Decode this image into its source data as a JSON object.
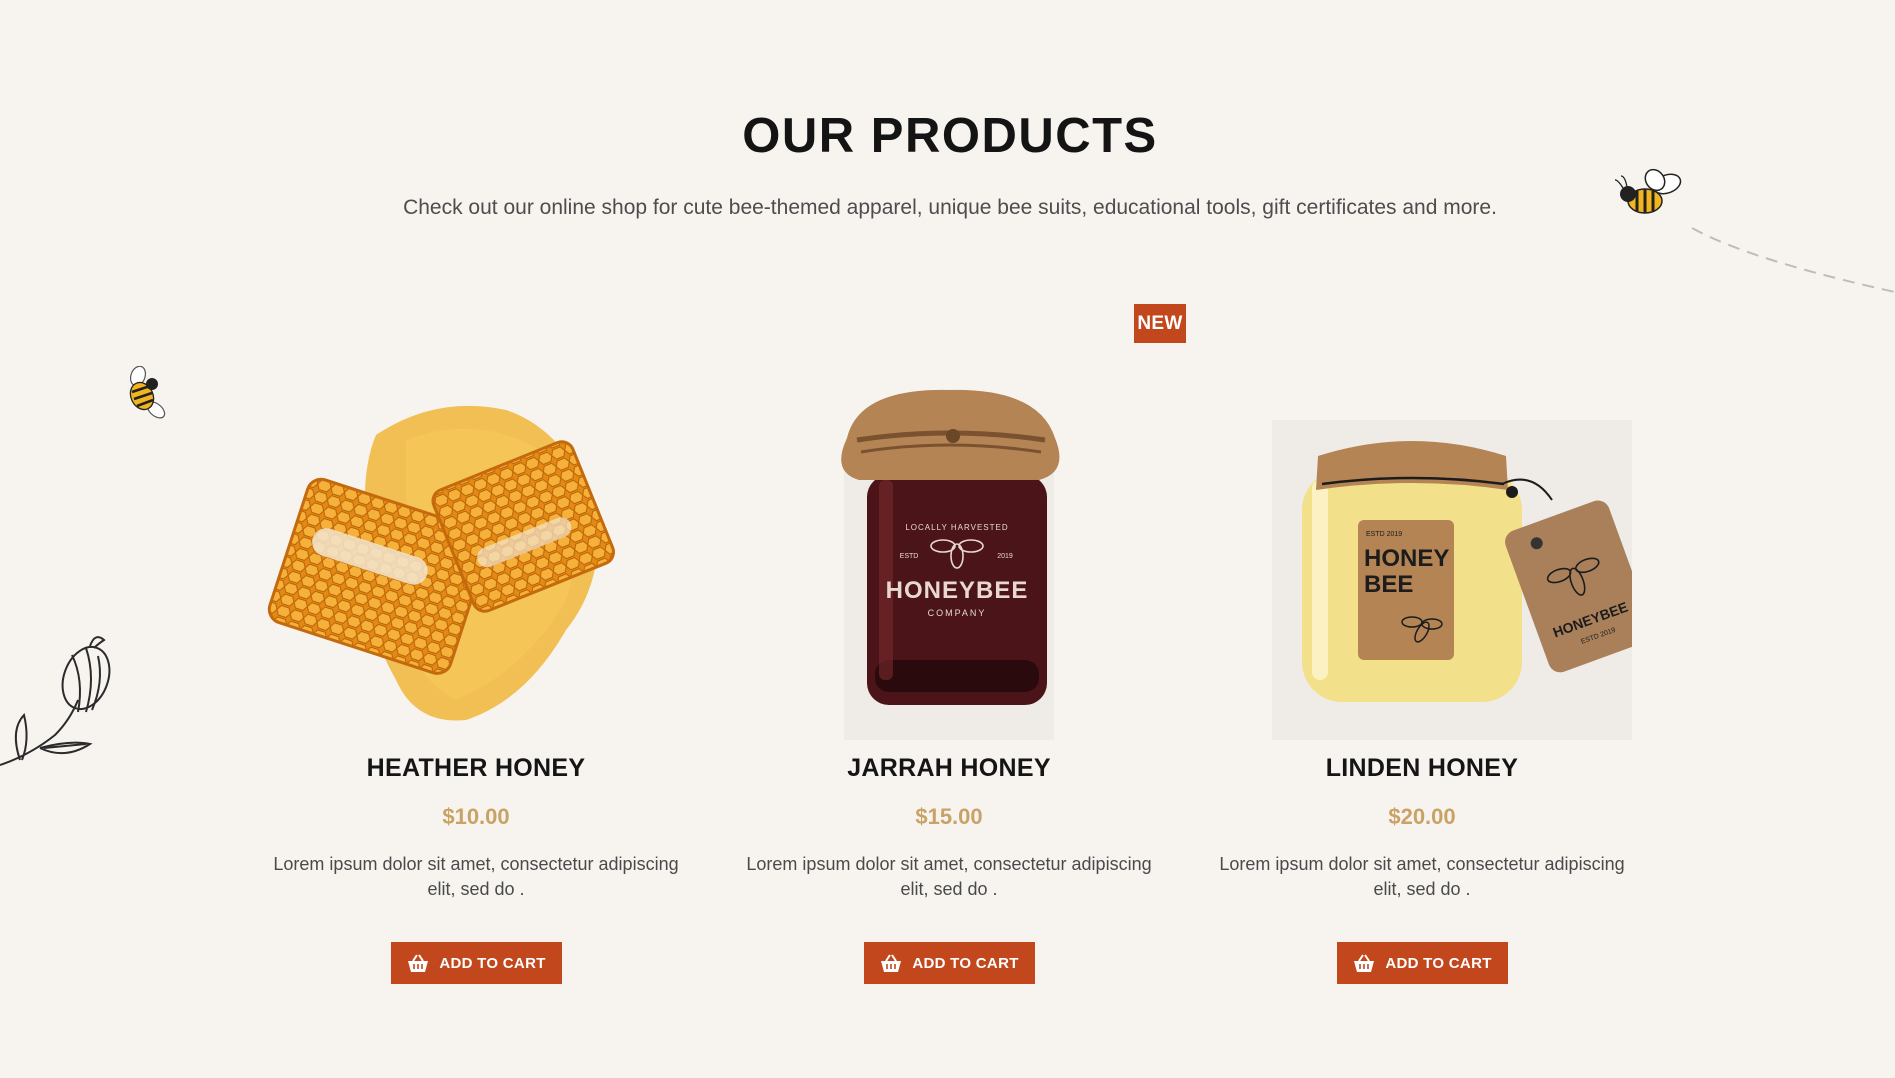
{
  "section": {
    "title": "OUR PRODUCTS",
    "subtitle": "Check out our online shop for cute bee-themed apparel, unique bee suits, educational tools, gift certificates and more."
  },
  "badge": {
    "label": "NEW"
  },
  "products": [
    {
      "name": "HEATHER HONEY",
      "price": "$10.00",
      "description": "Lorem ipsum dolor sit amet, consectetur adipiscing elit, sed do .",
      "button_label": "ADD TO CART",
      "image": "honeycomb-pieces"
    },
    {
      "name": "JARRAH HONEY",
      "price": "$15.00",
      "description": "Lorem ipsum dolor sit amet, consectetur adipiscing elit, sed do .",
      "button_label": "ADD TO CART",
      "image": "dark-honey-jar",
      "jar_label": {
        "arc": "LOCALLY HARVESTED",
        "estd": "ESTD",
        "year": "2019",
        "brand": "HONEYBEE",
        "company": "COMPANY"
      }
    },
    {
      "name": "LINDEN HONEY",
      "price": "$20.00",
      "description": "Lorem ipsum dolor sit amet, consectetur adipiscing elit, sed do .",
      "button_label": "ADD TO CART",
      "image": "light-honey-jar-with-tag",
      "jar_label": {
        "estd": "ESTD 2019",
        "line1": "HONEY",
        "line2": "BEE",
        "tag_text": "HONEYBEE",
        "tag_sub": "ESTD 2019"
      }
    }
  ],
  "icons": {
    "cart": "basket-icon",
    "decor_bee": "bee-icon",
    "decor_flower": "flower-sketch-icon"
  },
  "colors": {
    "background": "#f7f4f0",
    "accent": "#c3471d",
    "price": "#c9a266",
    "honey": "#e9a020",
    "jar_dark": "#4a1418",
    "jar_light": "#f3e08a"
  }
}
